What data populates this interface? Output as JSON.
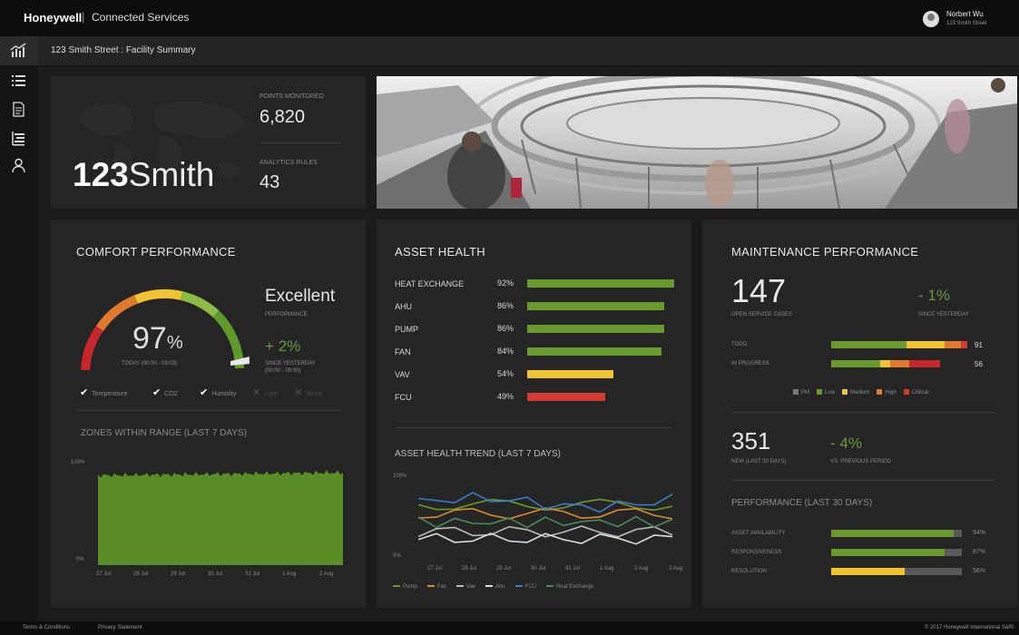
{
  "header": {
    "brand": "Honeywell",
    "separator": "|",
    "app_name": "Connected Services",
    "user_name": "Norbert Wu",
    "user_address": "123 Smith Street"
  },
  "subheader": {
    "title": "123 Smith Street : Facility Summary"
  },
  "sidebar": {
    "icons": [
      "chart-icon",
      "list-icon",
      "document-icon",
      "hierarchy-icon",
      "user-icon"
    ]
  },
  "facility": {
    "name_bold": "123",
    "name_light": "Smith",
    "points_label": "POINTS MONITORED",
    "points_value": "6,820",
    "rules_label": "ANALYTICS RULES",
    "rules_value": "43"
  },
  "comfort": {
    "title": "COMFORT PERFORMANCE",
    "percent": "97",
    "percent_unit": "%",
    "percent_value": 97,
    "today_label": "TODAY (00:00 - 09:00)",
    "rating": "Excellent",
    "rating_sub": "PERFORMANCE",
    "change": "+ 2%",
    "change_label_1": "SINCE YESTERDAY",
    "change_label_2": "(00:00 - 09:00)",
    "checks": [
      {
        "label": "Temperature",
        "mark": "✔",
        "on": true
      },
      {
        "label": "CO2",
        "mark": "✔",
        "on": true
      },
      {
        "label": "Humidity",
        "mark": "✔",
        "on": true
      },
      {
        "label": "Light",
        "mark": "✕",
        "on": false
      },
      {
        "label": "Noise",
        "mark": "✕",
        "on": false
      }
    ],
    "zones_title": "ZONES WITHIN RANGE (LAST 7 DAYS)",
    "zones_y_top": "100%",
    "zones_y_bottom": "0%",
    "zones_x": [
      "27 Jul",
      "28 Jul",
      "29 Jul",
      "30 Jul",
      "31 Jul",
      "1 Aug",
      "2 Aug"
    ]
  },
  "asset": {
    "title": "ASSET HEALTH",
    "rows": [
      {
        "label": "HEAT EXCHANGE",
        "pct": "92%",
        "value": 92,
        "color": "#6a9a2e"
      },
      {
        "label": "AHU",
        "pct": "86%",
        "value": 86,
        "color": "#6a9a2e"
      },
      {
        "label": "PUMP",
        "pct": "86%",
        "value": 86,
        "color": "#6a9a2e"
      },
      {
        "label": "FAN",
        "pct": "84%",
        "value": 84,
        "color": "#6a9a2e"
      },
      {
        "label": "VAV",
        "pct": "54%",
        "value": 54,
        "color": "#f1c232"
      },
      {
        "label": "FCU",
        "pct": "49%",
        "value": 49,
        "color": "#d33a31"
      }
    ],
    "trend_title": "ASSET HEALTH TREND  (LAST 7 DAYS)",
    "trend_y_top": "100%",
    "trend_y_bottom": "0%",
    "trend_x": [
      "27 Jul",
      "28 Jul",
      "29 Jul",
      "30 Jul",
      "31 Jul",
      "1 Aug",
      "2 Aug",
      "3 Aug"
    ],
    "trend_legend": [
      {
        "name": "Pump",
        "color": "#6a9a2e"
      },
      {
        "name": "Fan",
        "color": "#e08a2e"
      },
      {
        "name": "Vav",
        "color": "#bbbbbb"
      },
      {
        "name": "Ahu",
        "color": "#dddddd"
      },
      {
        "name": "FCU",
        "color": "#3b7dc4"
      },
      {
        "name": "Heat Exchange",
        "color": "#4a8a5e"
      }
    ]
  },
  "maintenance": {
    "title": "MAINTENANCE PERFORMANCE",
    "open_cases": "147",
    "open_label": "OPEN SERVICE CASES",
    "open_change": "- 1%",
    "open_change_label": "SINCE YESTERDAY",
    "status_rows": [
      {
        "label": "TODO",
        "count": "91",
        "segments": [
          {
            "color": "#6a9a2e",
            "value": 0.55
          },
          {
            "color": "#f1c232",
            "value": 0.28
          },
          {
            "color": "#e0782e",
            "value": 0.12
          },
          {
            "color": "#d33a31",
            "value": 0.05
          }
        ]
      },
      {
        "label": "IN PROGRESS",
        "count": "56",
        "segments": [
          {
            "color": "#6a9a2e",
            "value": 0.36
          },
          {
            "color": "#f1c232",
            "value": 0.07
          },
          {
            "color": "#e0782e",
            "value": 0.14
          },
          {
            "color": "#c9262c",
            "value": 0.23
          }
        ]
      }
    ],
    "legend": [
      {
        "name": "PM",
        "color": "#777777"
      },
      {
        "name": "Low",
        "color": "#6a9a2e"
      },
      {
        "name": "Medium",
        "color": "#f1c232"
      },
      {
        "name": "High",
        "color": "#e0782e"
      },
      {
        "name": "Critical",
        "color": "#d33a31"
      }
    ],
    "new_cases": "351",
    "new_label": "NEW (LAST 30 DAYS)",
    "new_change": "- 4%",
    "new_change_label": "VS. PREVIOUS PERIOD",
    "perf_title": "PERFORMANCE  (LAST 30 DAYS)",
    "perf_rows": [
      {
        "label": "ASSET AVAILABILITY",
        "pct": "94%",
        "value": 94,
        "color": "#6a9a2e"
      },
      {
        "label": "RESPONSIVENESS",
        "pct": "87%",
        "value": 87,
        "color": "#6a9a2e"
      },
      {
        "label": "RESOLUTION",
        "pct": "56%",
        "value": 56,
        "color": "#f1c232"
      }
    ]
  },
  "footer": {
    "terms": "Terms & Conditions",
    "privacy": "Privacy Statement",
    "copyright": "© 2017 Honeywell International SàRl"
  }
}
